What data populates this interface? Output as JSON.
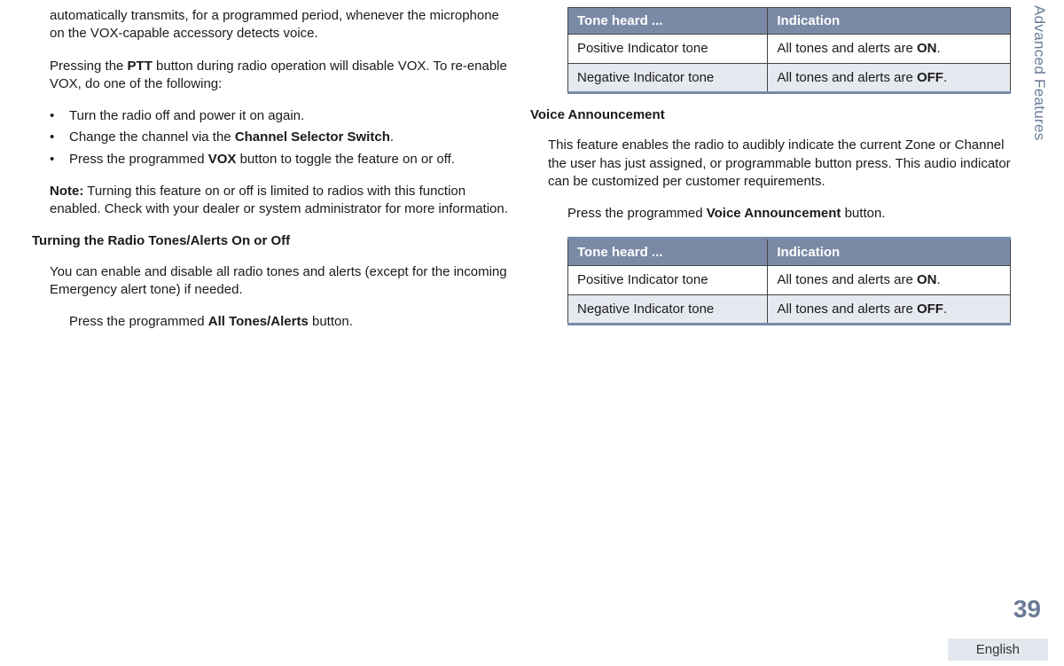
{
  "sideTab": "Advanced Features",
  "pageNumber": "39",
  "language": "English",
  "left": {
    "p1_a": "automatically transmits, for a programmed period, whenever the microphone on the VOX-capable accessory detects voice.",
    "p2_a": "Pressing the ",
    "p2_b": "PTT",
    "p2_c": " button during radio operation will disable VOX. To re-enable VOX, do one of the following:",
    "li1": "Turn the radio off and power it on again.",
    "li2_a": "Change the channel via the ",
    "li2_b": "Channel Selector Switch",
    "li2_c": ".",
    "li3_a": "Press the programmed ",
    "li3_b": "VOX",
    "li3_c": " button to toggle the feature on or off.",
    "note_label": "Note:",
    "note_text": " Turning this feature on or off is limited to radios with this function enabled. Check with your dealer or system administrator for more information.",
    "h1": "Turning the Radio Tones/Alerts On or Off",
    "p3": "You can enable and disable all radio tones and alerts (except for the incoming Emergency alert tone) if needed.",
    "p4_a": "Press the programmed ",
    "p4_b": "All Tones/Alerts",
    "p4_c": " button."
  },
  "right": {
    "th1": "Tone heard ...",
    "th2": "Indication",
    "r1c1": "Positive Indicator tone",
    "r1c2_a": "All tones and alerts are ",
    "r1c2_b": "ON",
    "r1c2_c": ".",
    "r2c1": "Negative Indicator tone",
    "r2c2_a": "All tones and alerts are ",
    "r2c2_b": "OFF",
    "r2c2_c": ".",
    "h2": "Voice Announcement",
    "p5": "This feature enables the radio to audibly indicate the current Zone or Channel the user has just assigned, or programmable button press. This audio indicator can be customized per customer requirements.",
    "p6_a": "Press the programmed ",
    "p6_b": "Voice Announcement",
    "p6_c": " button.",
    "t2": {
      "th1": "Tone heard ...",
      "th2": "Indication",
      "r1c1": "Positive Indicator tone",
      "r1c2_a": "All tones and alerts are ",
      "r1c2_b": "ON",
      "r1c2_c": ".",
      "r2c1": "Negative Indicator tone",
      "r2c2_a": "All tones and alerts are ",
      "r2c2_b": "OFF",
      "r2c2_c": "."
    }
  }
}
